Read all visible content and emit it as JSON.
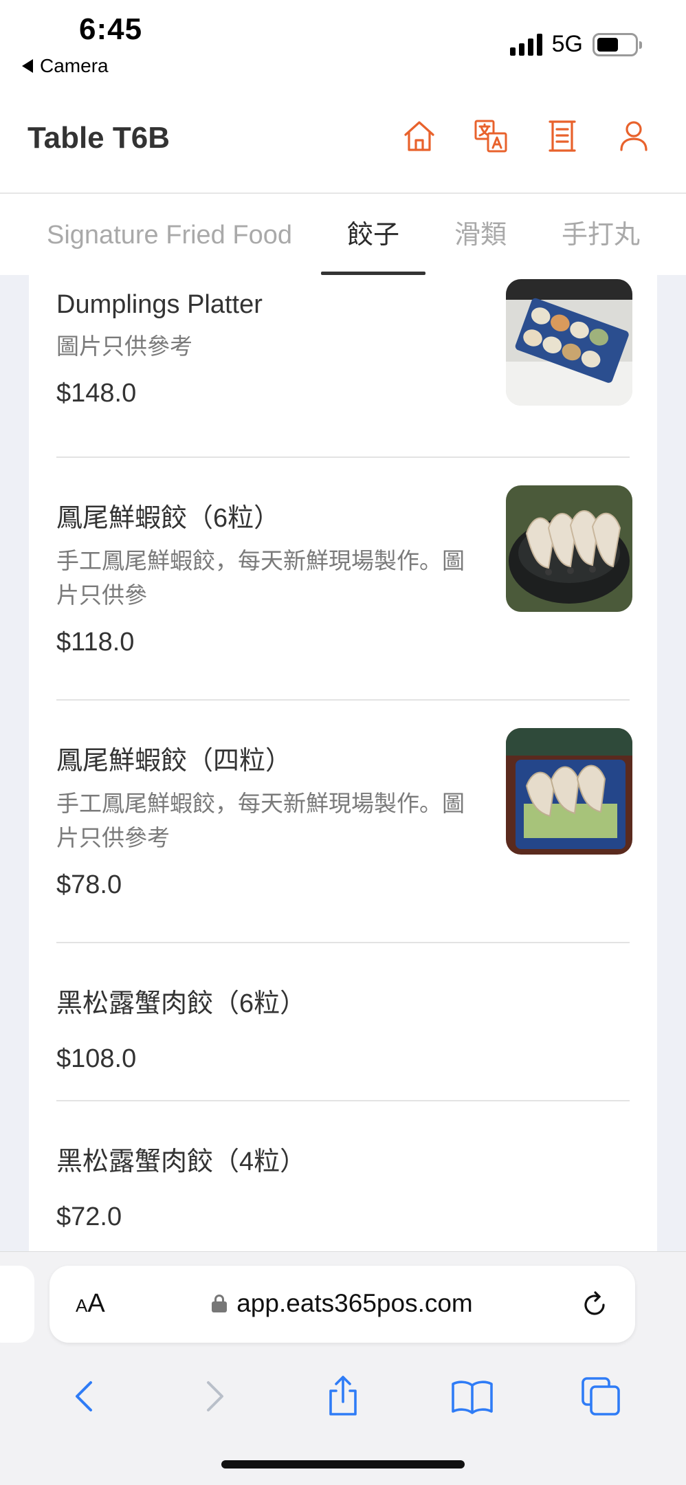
{
  "status": {
    "time": "6:45",
    "back_label": "Camera",
    "network": "5G"
  },
  "header": {
    "table_title": "Table T6B",
    "icons": [
      "home-icon",
      "translate-icon",
      "receipt-icon",
      "account-icon"
    ],
    "accent_color": "#e8622c"
  },
  "tabs": [
    {
      "label": "Signature Fried Food",
      "active": false
    },
    {
      "label": "餃子",
      "active": true
    },
    {
      "label": "滑類",
      "active": false
    },
    {
      "label": "手打丸",
      "active": false
    }
  ],
  "items": [
    {
      "name": "Dumplings Platter",
      "desc": "圖片只供參考",
      "price": "$148.0",
      "has_image": true
    },
    {
      "name": "鳳尾鮮蝦餃（6粒）",
      "desc": "手工鳳尾鮮蝦餃，每天新鮮現場製作。圖片只供參",
      "price": "$118.0",
      "has_image": true
    },
    {
      "name": "鳳尾鮮蝦餃（四粒）",
      "desc": "手工鳳尾鮮蝦餃，每天新鮮現場製作。圖片只供參考",
      "price": "$78.0",
      "has_image": true
    },
    {
      "name": "黑松露蟹肉餃（6粒）",
      "desc": "",
      "price": "$108.0",
      "has_image": false
    },
    {
      "name": "黑松露蟹肉餃（4粒）",
      "desc": "",
      "price": "$72.0",
      "has_image": false
    }
  ],
  "browser": {
    "aa_label_small": "A",
    "aa_label_large": "A",
    "url": "app.eats365pos.com"
  }
}
